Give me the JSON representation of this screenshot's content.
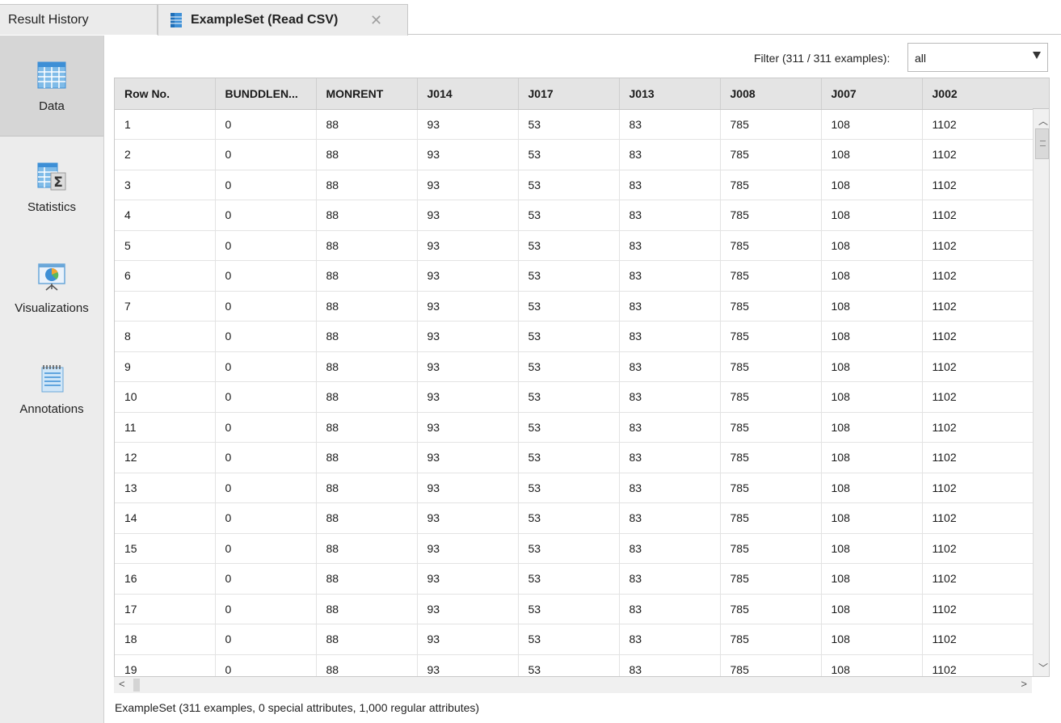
{
  "tabs": [
    {
      "label": "Result History"
    },
    {
      "label": "ExampleSet (Read CSV)"
    }
  ],
  "sidebar": {
    "items": [
      {
        "label": "Data"
      },
      {
        "label": "Statistics"
      },
      {
        "label": "Visualizations"
      },
      {
        "label": "Annotations"
      }
    ]
  },
  "filter": {
    "label": "Filter (311 / 311 examples):",
    "value": "all"
  },
  "table": {
    "columns": [
      "Row No.",
      "BUNDDLEN...",
      "MONRENT",
      "J014",
      "J017",
      "J013",
      "J008",
      "J007",
      "J002"
    ],
    "rows": [
      [
        "1",
        "0",
        "88",
        "93",
        "53",
        "83",
        "785",
        "108",
        "1102"
      ],
      [
        "2",
        "0",
        "88",
        "93",
        "53",
        "83",
        "785",
        "108",
        "1102"
      ],
      [
        "3",
        "0",
        "88",
        "93",
        "53",
        "83",
        "785",
        "108",
        "1102"
      ],
      [
        "4",
        "0",
        "88",
        "93",
        "53",
        "83",
        "785",
        "108",
        "1102"
      ],
      [
        "5",
        "0",
        "88",
        "93",
        "53",
        "83",
        "785",
        "108",
        "1102"
      ],
      [
        "6",
        "0",
        "88",
        "93",
        "53",
        "83",
        "785",
        "108",
        "1102"
      ],
      [
        "7",
        "0",
        "88",
        "93",
        "53",
        "83",
        "785",
        "108",
        "1102"
      ],
      [
        "8",
        "0",
        "88",
        "93",
        "53",
        "83",
        "785",
        "108",
        "1102"
      ],
      [
        "9",
        "0",
        "88",
        "93",
        "53",
        "83",
        "785",
        "108",
        "1102"
      ],
      [
        "10",
        "0",
        "88",
        "93",
        "53",
        "83",
        "785",
        "108",
        "1102"
      ],
      [
        "11",
        "0",
        "88",
        "93",
        "53",
        "83",
        "785",
        "108",
        "1102"
      ],
      [
        "12",
        "0",
        "88",
        "93",
        "53",
        "83",
        "785",
        "108",
        "1102"
      ],
      [
        "13",
        "0",
        "88",
        "93",
        "53",
        "83",
        "785",
        "108",
        "1102"
      ],
      [
        "14",
        "0",
        "88",
        "93",
        "53",
        "83",
        "785",
        "108",
        "1102"
      ],
      [
        "15",
        "0",
        "88",
        "93",
        "53",
        "83",
        "785",
        "108",
        "1102"
      ],
      [
        "16",
        "0",
        "88",
        "93",
        "53",
        "83",
        "785",
        "108",
        "1102"
      ],
      [
        "17",
        "0",
        "88",
        "93",
        "53",
        "83",
        "785",
        "108",
        "1102"
      ],
      [
        "18",
        "0",
        "88",
        "93",
        "53",
        "83",
        "785",
        "108",
        "1102"
      ],
      [
        "19",
        "0",
        "88",
        "93",
        "53",
        "83",
        "785",
        "108",
        "1102"
      ]
    ]
  },
  "status": "ExampleSet (311 examples, 0 special attributes, 1,000 regular attributes)",
  "icons": {
    "tab_icon": "table-icon",
    "data_icon": "grid-table-icon",
    "statistics_icon": "sigma-table-icon",
    "visualizations_icon": "presentation-chart-icon",
    "annotations_icon": "notepad-icon",
    "close_icon": "close-icon"
  },
  "colors": {
    "accent_blue": "#3d8fd6",
    "sidebar_bg": "#ececec",
    "sidebar_selected": "#d6d6d6",
    "header_bg": "#e4e4e4"
  }
}
